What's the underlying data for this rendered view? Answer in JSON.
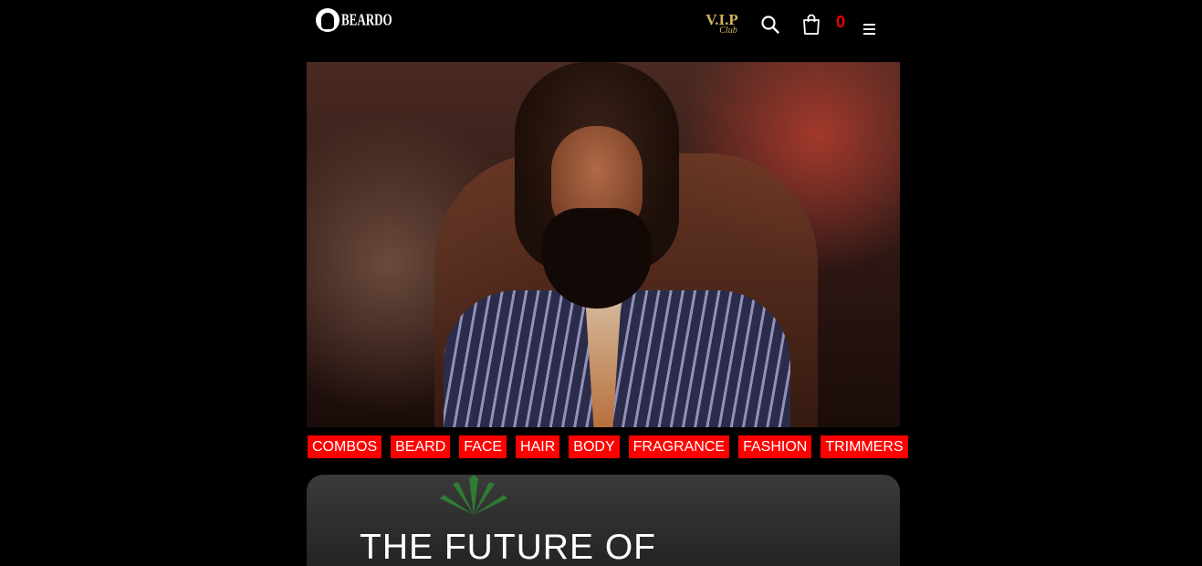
{
  "brand": {
    "logo_text": "BEARDO"
  },
  "header": {
    "vip_main": "V.I.P",
    "vip_sub": "Club",
    "cart_count": "0"
  },
  "categories": [
    "COMBOS",
    "BEARD",
    "FACE",
    "HAIR",
    "BODY",
    "FRAGRANCE",
    "FASHION",
    "TRIMMERS"
  ],
  "promo": {
    "title": "THE FUTURE OF"
  },
  "colors": {
    "background": "#000000",
    "category_bg": "#ff0000",
    "cart_count": "#ee0000",
    "vip_gold": "#d4b35a"
  },
  "icons": {
    "logo": "beard-face-icon",
    "search": "search-icon",
    "cart": "shopping-bag-icon",
    "menu": "hamburger-menu-icon"
  }
}
